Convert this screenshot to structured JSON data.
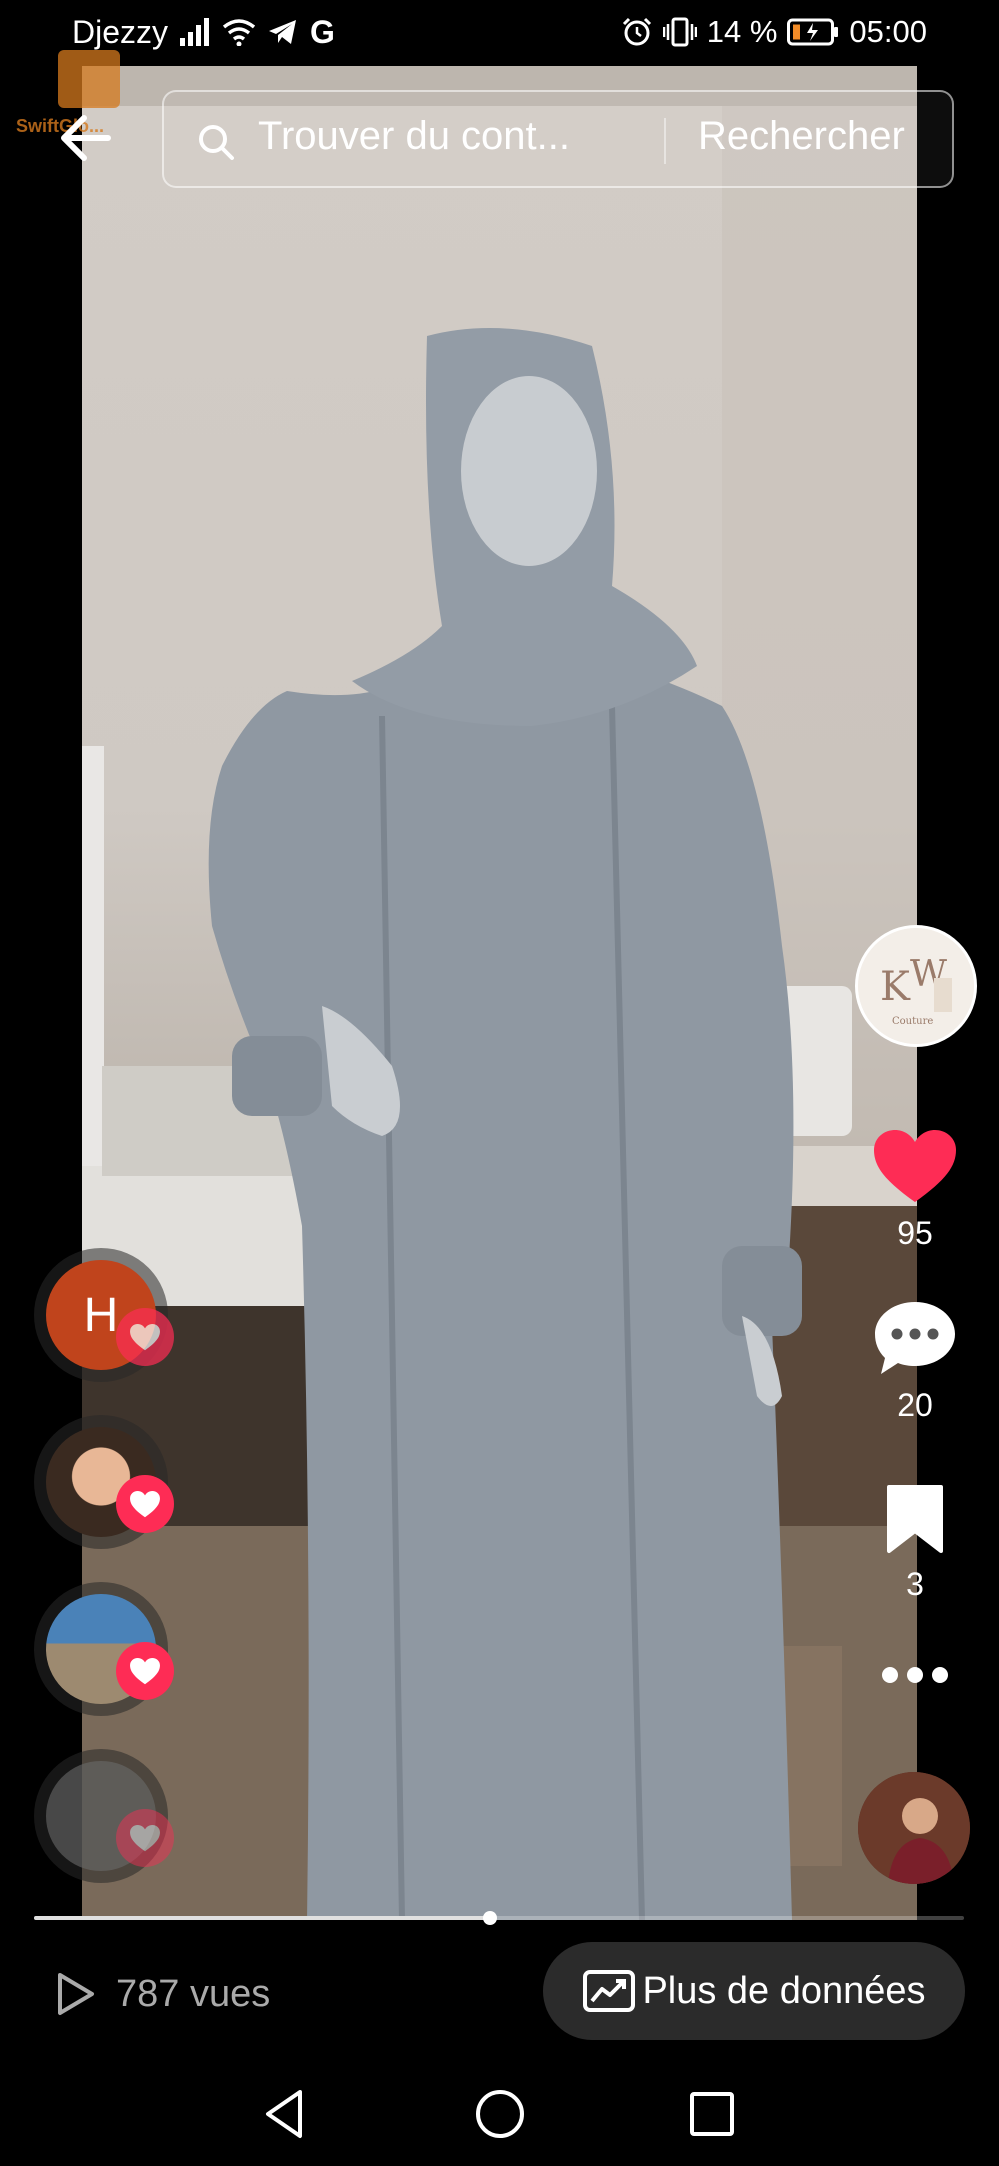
{
  "status_bar": {
    "carrier": "Djezzy",
    "battery": "14 %",
    "time": "05:00"
  },
  "watermark": {
    "text": "SwiftGlo..."
  },
  "search": {
    "placeholder": "Trouver du cont...",
    "button_label": "Rechercher"
  },
  "actions": {
    "likes": "95",
    "comments": "20",
    "saves": "3"
  },
  "likers": [
    {
      "initial": "H",
      "color": "#c0441c"
    },
    {
      "initial": "",
      "color": "#7a5a40"
    },
    {
      "initial": "",
      "color": "#4a82b8"
    },
    {
      "initial": "",
      "color": "#555555"
    }
  ],
  "stats": {
    "views": "787 vues",
    "more_data_label": "Plus de données"
  },
  "playback": {
    "progress": 0.49
  },
  "colors": {
    "accent": "#fe2c55",
    "pill_bg": "#2b2b2b"
  }
}
